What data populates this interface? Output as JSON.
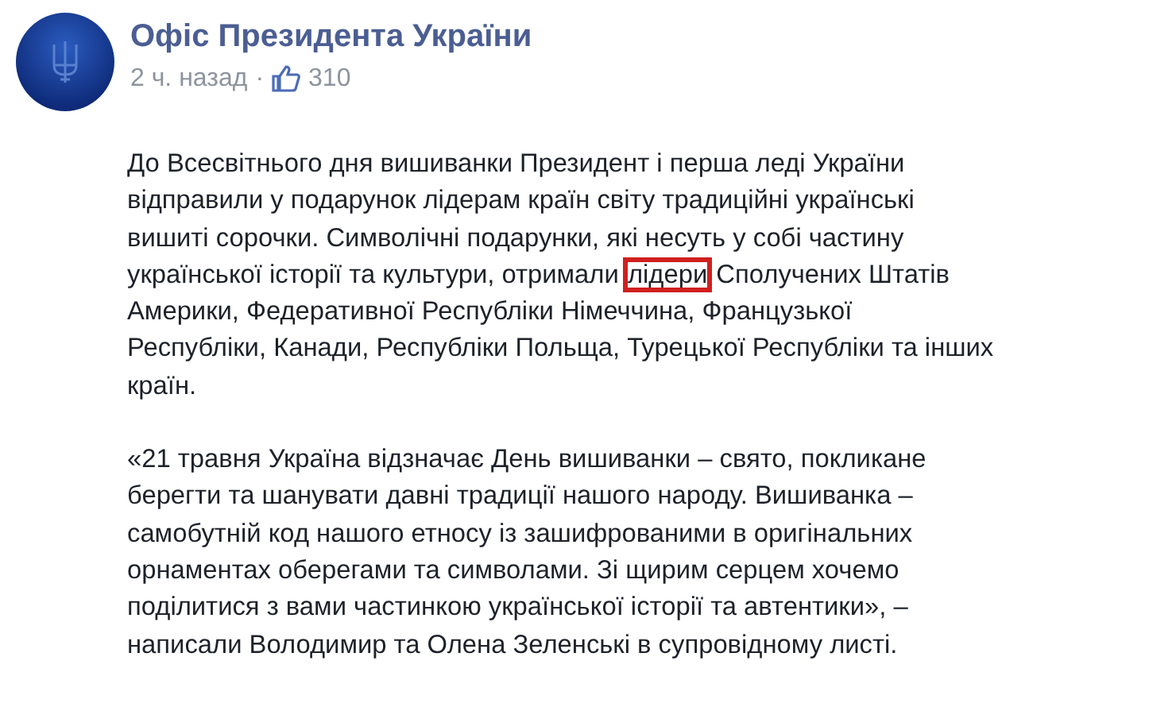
{
  "post": {
    "author": "Офіс Президента України",
    "time": "2 ч. назад",
    "separator": "·",
    "likes": "310",
    "paragraphs": [
      {
        "lines": [
          [
            {
              "text": "До Всесвітнього дня вишиванки Президент і перша леді України",
              "boxed": false
            }
          ],
          [
            {
              "text": "відправили у подарунок лідерам країн світу традиційні українські",
              "boxed": false
            }
          ],
          [
            {
              "text": "вишиті сорочки. Символічні подарунки, які несуть у собі частину",
              "boxed": false
            }
          ],
          [
            {
              "text": "української історії та культури, отримали ",
              "boxed": false
            },
            {
              "text": "лідери",
              "boxed": true
            },
            {
              "text": " Сполучених Штатів",
              "boxed": false
            }
          ],
          [
            {
              "text": "Америки, Федеративної Республіки Німеччина, Французької",
              "boxed": false
            }
          ],
          [
            {
              "text": "Республіки, Канади, Республіки Польща, Турецької Республіки та інших",
              "boxed": false
            }
          ],
          [
            {
              "text": "країн.",
              "boxed": false
            }
          ]
        ]
      },
      {
        "lines": [
          [
            {
              "text": "«21 травня Україна відзначає День вишиванки – свято, покликане",
              "boxed": false
            }
          ],
          [
            {
              "text": "берегти та шанувати давні традиції нашого народу. Вишиванка –",
              "boxed": false
            }
          ],
          [
            {
              "text": "самобутній код нашого етносу із зашифрованими в оригінальних",
              "boxed": false
            }
          ],
          [
            {
              "text": "орнаментах оберегами та символами. Зі щирим серцем хочемо",
              "boxed": false
            }
          ],
          [
            {
              "text": "поділитися з вами частинкою української історії та автентики», –",
              "boxed": false
            }
          ],
          [
            {
              "text": "написали Володимир та Олена Зеленські в супровідному листі.",
              "boxed": false
            }
          ]
        ]
      }
    ]
  }
}
